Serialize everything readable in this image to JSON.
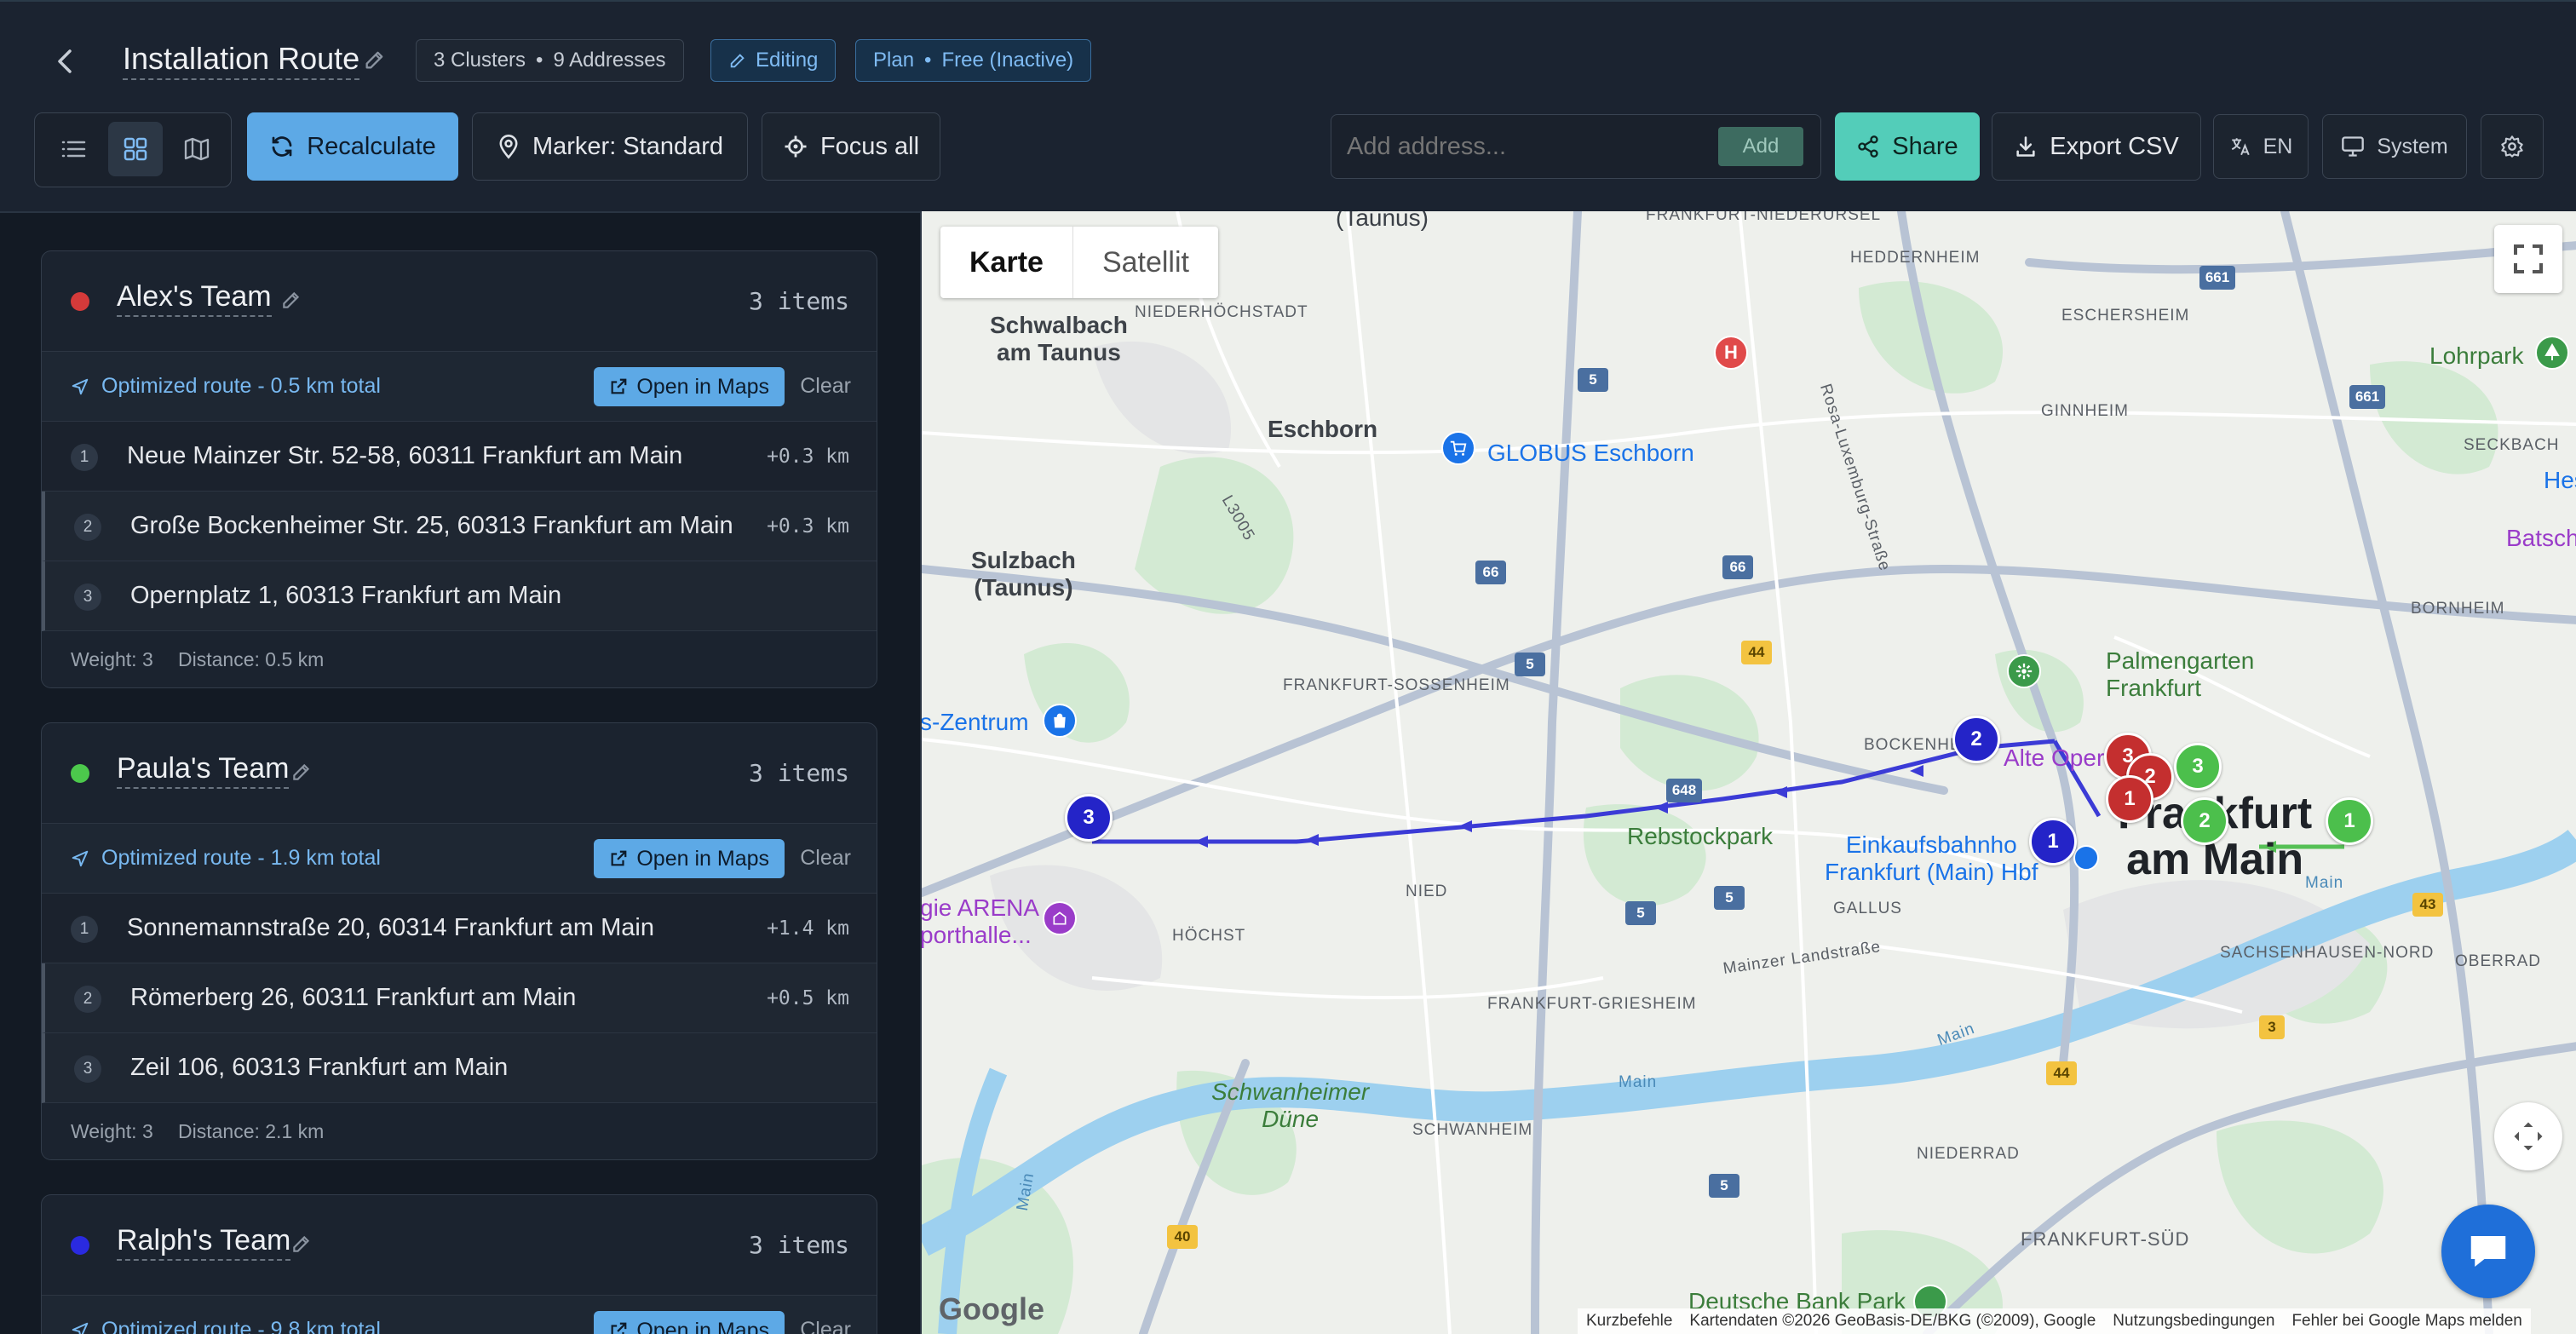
{
  "header": {
    "title": "Installation Route",
    "clusters_chip": "3 Clusters",
    "chip_sep": "•",
    "addresses_chip": "9 Addresses",
    "editing_chip": "Editing",
    "plan_chip": "Plan",
    "plan_detail": "Free (Inactive)"
  },
  "toolbar": {
    "recalculate": "Recalculate",
    "marker": "Marker: Standard",
    "focus_all": "Focus all",
    "address_placeholder": "Add address...",
    "add": "Add",
    "share": "Share",
    "export": "Export CSV",
    "lang": "EN",
    "theme": "System"
  },
  "clusters": [
    {
      "name": "Alex's Team",
      "color": "#d43a3a",
      "count": "3 items",
      "route": "Optimized route - 0.5 km total",
      "open": "Open in Maps",
      "clear": "Clear",
      "items": [
        {
          "n": "1",
          "addr": "Neue Mainzer Str. 52-58, 60311 Frankfurt am Main",
          "km": "+0.3 km"
        },
        {
          "n": "2",
          "addr": "Große Bockenheimer Str. 25, 60313 Frankfurt am Main",
          "km": "+0.3 km"
        },
        {
          "n": "3",
          "addr": "Opernplatz 1, 60313 Frankfurt am Main",
          "km": ""
        }
      ],
      "weight": "Weight: 3",
      "distance": "Distance: 0.5 km"
    },
    {
      "name": "Paula's Team",
      "color": "#4cc94c",
      "count": "3 items",
      "route": "Optimized route - 1.9 km total",
      "open": "Open in Maps",
      "clear": "Clear",
      "items": [
        {
          "n": "1",
          "addr": "Sonnemannstraße 20, 60314 Frankfurt am Main",
          "km": "+1.4 km"
        },
        {
          "n": "2",
          "addr": "Römerberg 26, 60311 Frankfurt am Main",
          "km": "+0.5 km"
        },
        {
          "n": "3",
          "addr": "Zeil 106, 60313 Frankfurt am Main",
          "km": ""
        }
      ],
      "weight": "Weight: 3",
      "distance": "Distance: 2.1 km"
    },
    {
      "name": "Ralph's Team",
      "color": "#2a2ae0",
      "count": "3 items",
      "route": "Optimized route - 9.8 km total",
      "open": "Open in Maps",
      "clear": "Clear"
    }
  ],
  "map": {
    "tab_map": "Karte",
    "tab_sat": "Satellit",
    "google": "Google",
    "attr_shortcuts": "Kurzbefehle",
    "attr_data": "Kartendaten ©2026 GeoBasis-DE/BKG (©2009), Google",
    "attr_terms": "Nutzungsbedingungen",
    "attr_report": "Fehler bei Google Maps melden",
    "labels": {
      "taunus_top": "(Taunus)",
      "ffm_nieder": "FRANKFURT-NIEDERURSEL",
      "heddernheim": "HEDDERNHEIM",
      "niederhoechstadt": "NIEDERHÖCHSTADT",
      "schwalbach": "Schwalbach\nam Taunus",
      "eschersheim": "ESCHERSHEIM",
      "lohrpark": "Lohrpark",
      "rosa": "Rosa-Luxemburg-Straße",
      "eschborn": "Eschborn",
      "globus": "GLOBUS Eschborn",
      "ginnheim": "GINNHEIM",
      "seckbach": "SECKBACH",
      "hes": "Hes",
      "batschkapp": "Batschkap",
      "sulzbach": "Sulzbach\n(Taunus)",
      "l3005": "L3005",
      "palmengarten": "Palmengarten\nFrankfurt",
      "bornheim": "BORNHEIM",
      "sossenheim": "FRANKFURT-SOSSENHEIM",
      "zentrum": "s-Zentrum",
      "bockenheim": "BOCKENHEIM",
      "alte_oper": "Alte Oper",
      "rebstock": "Rebstockpark",
      "frankfurt": "Frankfurt\nam Main",
      "einkauf": "Einkaufsbahnho\nFrankfurt (Main) Hbf",
      "nied": "NIED",
      "gallus": "GALLUS",
      "arena": "gie ARENA\nporthalle...",
      "hoechst": "HÖCHST",
      "mainzer": "Mainzer Landstraße",
      "sachsenhausen": "SACHSENHAUSEN-NORD",
      "oberrad": "OBERRAD",
      "griesheim": "FRANKFURT-GRIESHEIM",
      "main1": "Main",
      "main2": "Main",
      "main3": "Main",
      "main4": "Main",
      "schwanheimer": "Schwanheimer\nDüne",
      "schwanheim": "SCHWANHEIM",
      "niederrad": "NIEDERRAD",
      "ffm_sued": "FRANKFURT-SÜD",
      "deutsche_bank": "Deutsche Bank Park"
    },
    "shields": [
      "5",
      "661",
      "661",
      "66",
      "66",
      "5",
      "44",
      "648",
      "5",
      "5",
      "44",
      "3",
      "43",
      "40",
      "5"
    ],
    "markers": [
      {
        "team": "blue",
        "n": "3"
      },
      {
        "team": "blue",
        "n": "2"
      },
      {
        "team": "blue",
        "n": "1"
      },
      {
        "team": "red",
        "n": "3"
      },
      {
        "team": "red",
        "n": "2"
      },
      {
        "team": "red",
        "n": "1"
      },
      {
        "team": "green",
        "n": "3"
      },
      {
        "team": "green",
        "n": "2"
      },
      {
        "team": "green",
        "n": "1"
      }
    ],
    "poi_hospital": "H"
  }
}
